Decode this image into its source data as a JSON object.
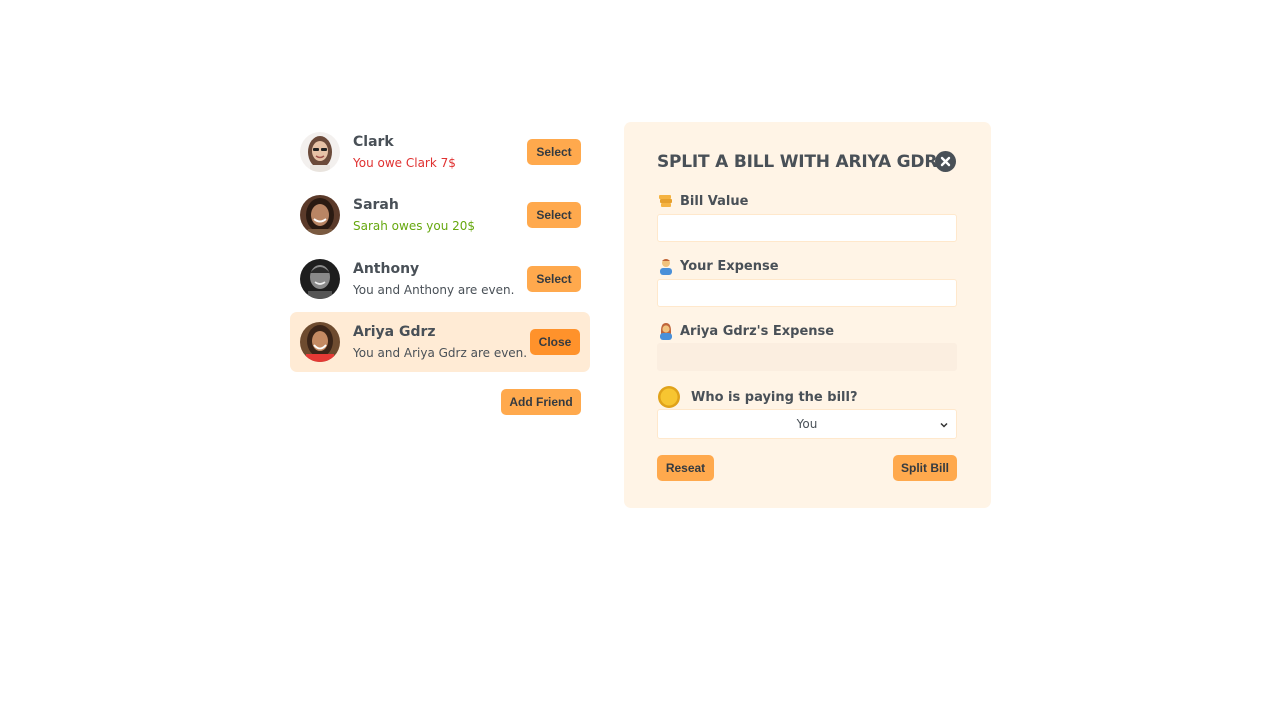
{
  "friends": [
    {
      "name": "Clark",
      "status": "You owe Clark 7$",
      "status_type": "red",
      "button": "Select"
    },
    {
      "name": "Sarah",
      "status": "Sarah owes you 20$",
      "status_type": "green",
      "button": "Select"
    },
    {
      "name": "Anthony",
      "status": "You and Anthony are even.",
      "status_type": "neutral",
      "button": "Select"
    },
    {
      "name": "Ariya Gdrz",
      "status": "You and Ariya Gdrz are even.",
      "status_type": "neutral",
      "button": "Close"
    }
  ],
  "add_friend_label": "Add Friend",
  "split": {
    "title": "SPLIT A BILL WITH ARIYA GDRZ",
    "close_icon": "close-icon",
    "bill_value_label": "Bill Value",
    "bill_value": "",
    "your_expense_label": "Your Expense",
    "your_expense": "",
    "friend_expense_label": "Ariya Gdrz's Expense",
    "friend_expense": "",
    "payer_label": "Who is paying the bill?",
    "payer_selected": "You",
    "reset_label": "Reseat",
    "split_label": "Split Bill"
  },
  "colors": {
    "accent": "#ffa94d",
    "accent_dark": "#ff922b",
    "panel_bg": "#fff4e6",
    "active_bg": "#ffebd5",
    "owe_red": "#e03131",
    "owed_green": "#66a80f"
  }
}
